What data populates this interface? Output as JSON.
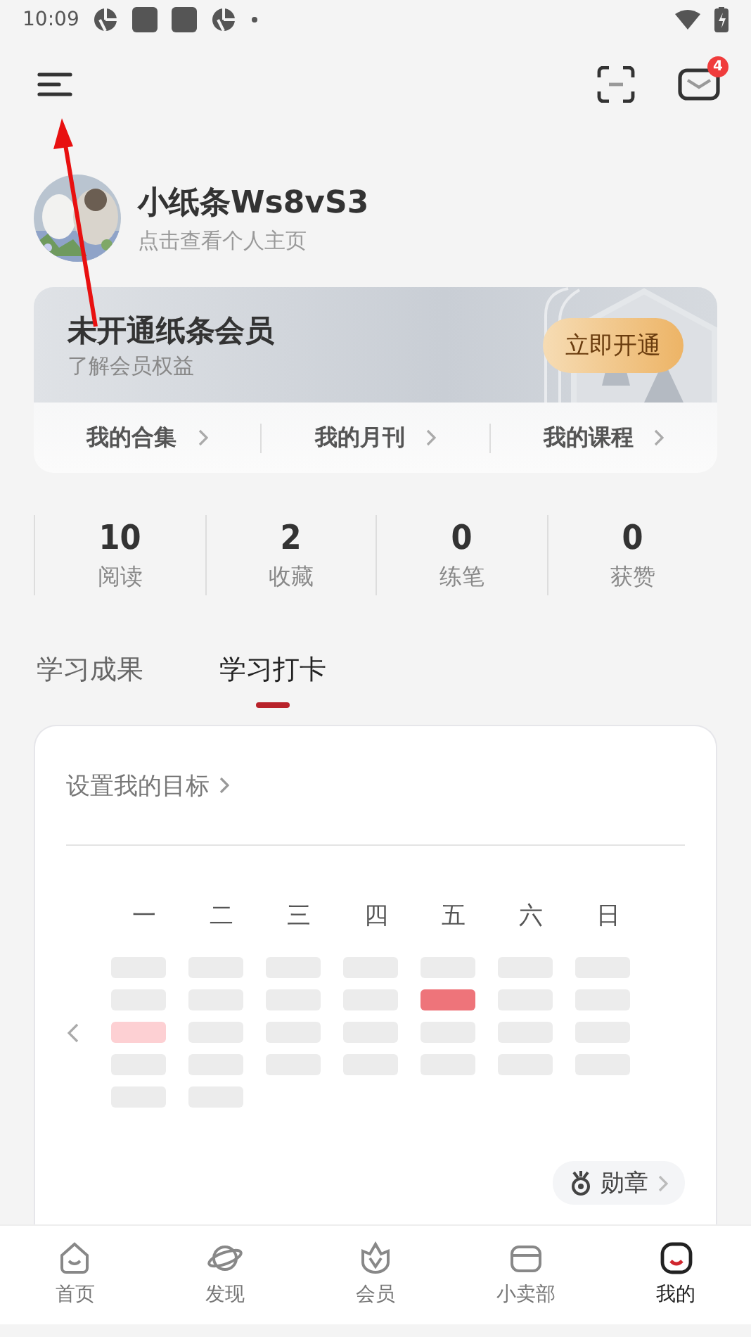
{
  "status_bar": {
    "time": "10:09"
  },
  "top_bar": {
    "mail_badge": "4"
  },
  "profile": {
    "name": "小纸条Ws8vS3",
    "subtitle": "点击查看个人主页"
  },
  "membership": {
    "title": "未开通纸条会员",
    "subtitle": "了解会员权益",
    "button": "立即开通",
    "links": [
      {
        "label": "我的合集"
      },
      {
        "label": "我的月刊"
      },
      {
        "label": "我的课程"
      }
    ]
  },
  "stats": [
    {
      "value": "10",
      "label": "阅读"
    },
    {
      "value": "2",
      "label": "收藏"
    },
    {
      "value": "0",
      "label": "练笔"
    },
    {
      "value": "0",
      "label": "获赞"
    }
  ],
  "tabs": [
    {
      "label": "学习成果",
      "selected": false
    },
    {
      "label": "学习打卡",
      "selected": true
    }
  ],
  "checkin": {
    "goal_link": "设置我的目标",
    "weekdays": [
      "一",
      "二",
      "三",
      "四",
      "五",
      "六",
      "日"
    ],
    "weeks": [
      [
        {
          "done": false,
          "today": false
        },
        {
          "done": false,
          "today": false
        },
        {
          "done": false,
          "today": false
        },
        {
          "done": false,
          "today": false
        },
        {
          "done": false,
          "today": false
        },
        {
          "done": false,
          "today": false
        },
        {
          "done": false,
          "today": false
        }
      ],
      [
        {
          "done": false,
          "today": false
        },
        {
          "done": false,
          "today": false
        },
        {
          "done": false,
          "today": false
        },
        {
          "done": false,
          "today": false
        },
        {
          "done": true,
          "today": false
        },
        {
          "done": false,
          "today": false
        },
        {
          "done": false,
          "today": false
        }
      ],
      [
        {
          "done": false,
          "today": true
        },
        {
          "done": false,
          "today": false
        },
        {
          "done": false,
          "today": false
        },
        {
          "done": false,
          "today": false
        },
        {
          "done": false,
          "today": false
        },
        {
          "done": false,
          "today": false
        },
        {
          "done": false,
          "today": false
        }
      ],
      [
        {
          "done": false,
          "today": false
        },
        {
          "done": false,
          "today": false
        },
        {
          "done": false,
          "today": false
        },
        {
          "done": false,
          "today": false
        },
        {
          "done": false,
          "today": false
        },
        {
          "done": false,
          "today": false
        },
        {
          "done": false,
          "today": false
        }
      ],
      [
        {
          "done": false,
          "today": false
        },
        {
          "done": false,
          "today": false
        }
      ]
    ],
    "badge_button": "勋章"
  },
  "bottom_nav": [
    {
      "label": "首页",
      "selected": false
    },
    {
      "label": "发现",
      "selected": false
    },
    {
      "label": "会员",
      "selected": false
    },
    {
      "label": "小卖部",
      "selected": false
    },
    {
      "label": "我的",
      "selected": true
    }
  ]
}
